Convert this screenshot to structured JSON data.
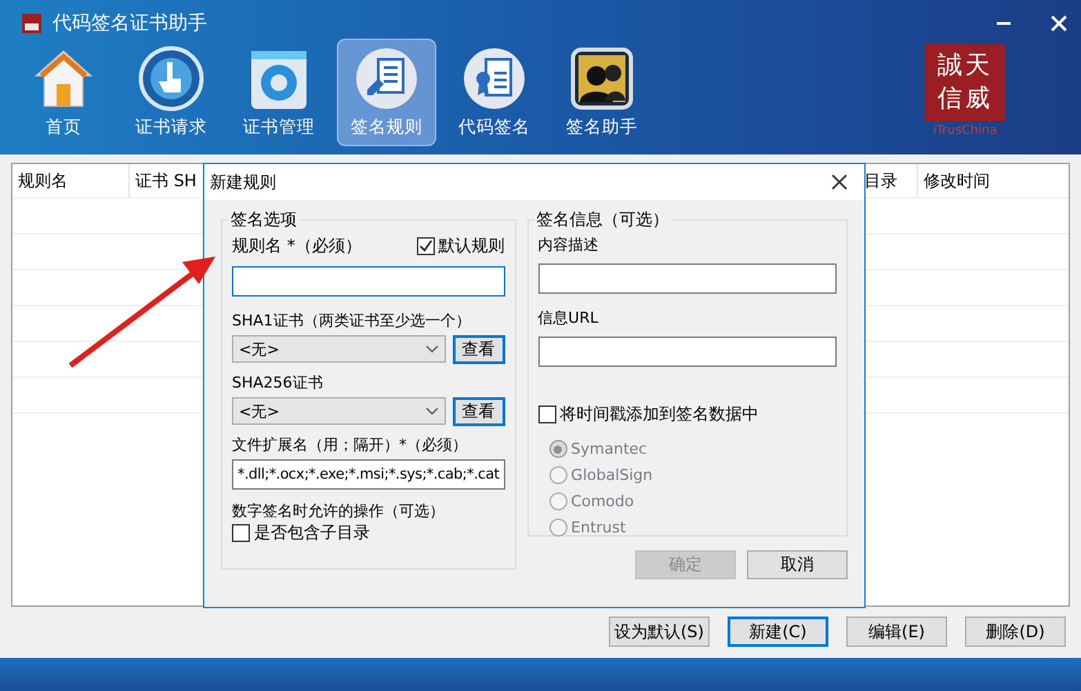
{
  "window": {
    "title": "代码签名证书助手"
  },
  "toolbar": [
    {
      "label": "首页",
      "kind": "home",
      "selected": false
    },
    {
      "label": "证书请求",
      "kind": "request",
      "selected": false
    },
    {
      "label": "证书管理",
      "kind": "manage",
      "selected": false
    },
    {
      "label": "签名规则",
      "kind": "rule",
      "selected": true
    },
    {
      "label": "代码签名",
      "kind": "sign",
      "selected": false
    },
    {
      "label": "签名助手",
      "kind": "helper",
      "selected": false
    }
  ],
  "brand": {
    "line_1": "誠天",
    "line_2": "信威",
    "tagline": "iTrusChina"
  },
  "table": {
    "columns": [
      "规则名",
      "证书 SH",
      "目录",
      "修改时间"
    ]
  },
  "dialog": {
    "title": "新建规则",
    "sign_options": {
      "title": "签名选项",
      "rule_name_label": "规则名 *（必须）",
      "default_rule": {
        "label": "默认规则",
        "checked": true
      },
      "sha1_label": "SHA1证书（两类证书至少选一个）",
      "sha1_value": "<无>",
      "sha1_button": "查看",
      "sha256_label": "SHA256证书",
      "sha256_value": "<无>",
      "sha256_button": "查看",
      "ext_label": "文件扩展名（用；隔开）*（必须）",
      "ext_value": "*.dll;*.ocx;*.exe;*.msi;*.sys;*.cab;*.cat",
      "ops_label": "数字签名时允许的操作（可选）",
      "subdir": {
        "label": "是否包含子目录",
        "checked": false
      }
    },
    "sign_info": {
      "title": "签名信息（可选）",
      "desc_label": "内容描述",
      "url_label": "信息URL",
      "timestamp": {
        "label": "将时间戳添加到签名数据中",
        "checked": false
      },
      "servers": [
        {
          "label": "Symantec",
          "selected": true,
          "disabled": true
        },
        {
          "label": "GlobalSign",
          "selected": false,
          "disabled": true
        },
        {
          "label": "Comodo",
          "selected": false,
          "disabled": true
        },
        {
          "label": "Entrust",
          "selected": false,
          "disabled": true
        }
      ]
    },
    "buttons": [
      {
        "label": "确定",
        "disabled": true
      },
      {
        "label": "取消",
        "disabled": false
      }
    ]
  },
  "buttons": [
    {
      "label": "设为默认(S)",
      "focused": false
    },
    {
      "label": "新建(C)",
      "focused": true
    },
    {
      "label": "编辑(E)",
      "focused": false
    },
    {
      "label": "删除(D)",
      "focused": false
    }
  ]
}
